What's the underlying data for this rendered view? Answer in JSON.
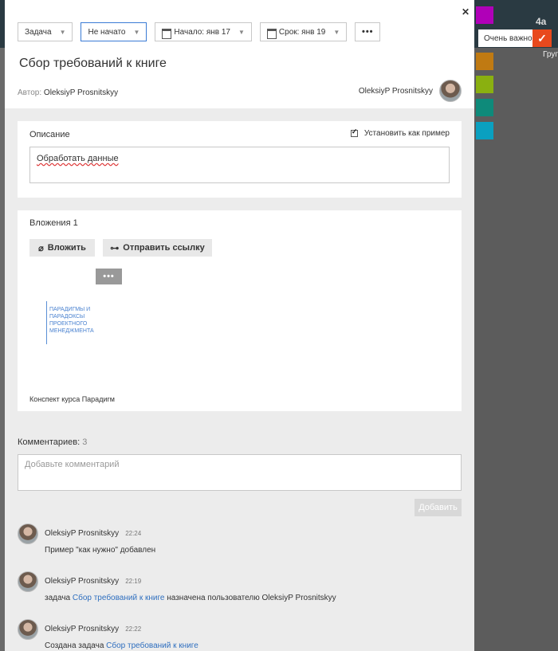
{
  "toolbar": {
    "type": "Задача",
    "status": "Не начато",
    "start": "Начало: янв 17",
    "due": "Срок: янв 19",
    "more": "•••"
  },
  "task": {
    "title": "Сбор требований к книге",
    "author_label": "Автор:",
    "author_name": "OleksiyP Prosnitskyy",
    "owner_name": "OleksiyP Prosnitskyy"
  },
  "description": {
    "header": "Описание",
    "example_label": "Установить как пример",
    "text": "Обработать данные"
  },
  "attachments": {
    "header": "Вложения 1",
    "attach_label": "Вложить",
    "send_link_label": "Отправить ссылку",
    "more": "•••",
    "file_name": "Конспект курса Парадигм",
    "thumb_title": "ПАРАДИГМЫ И ПАРАДОКСЫ ПРОЕКТНОГО МЕНЕДЖМЕНТА"
  },
  "comments": {
    "header_label": "Комментариев:",
    "count": "3",
    "placeholder": "Добавьте комментарий",
    "add_label": "Добавить",
    "items": [
      {
        "name": "OleksiyP Prosnitskyy",
        "time": "22:24",
        "pre": "Пример \"как нужно\" добавлен",
        "link": "",
        "post": ""
      },
      {
        "name": "OleksiyP Prosnitskyy",
        "time": "22:19",
        "pre": "задача ",
        "link": "Сбор требований к книге",
        "post": " назначена пользователю OleksiyP Prosnitskyy"
      },
      {
        "name": "OleksiyP Prosnitskyy",
        "time": "22:22",
        "pre": "Создана задача ",
        "link": "Сбор требований к книге",
        "post": ""
      }
    ]
  },
  "background": {
    "priority_label": "Очень важно",
    "group_label": "Груп"
  }
}
